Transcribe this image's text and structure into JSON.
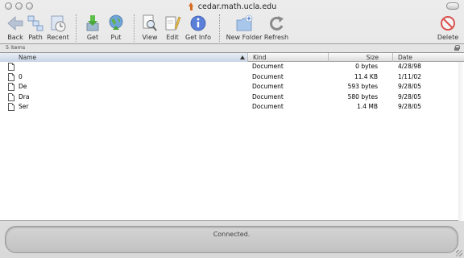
{
  "window": {
    "title": "cedar.math.ucla.edu"
  },
  "toolbar": {
    "back": "Back",
    "path": "Path",
    "recent": "Recent",
    "get": "Get",
    "put": "Put",
    "view": "View",
    "edit": "Edit",
    "get_info": "Get Info",
    "new_folder": "New Folder",
    "refresh": "Refresh",
    "delete": "Delete"
  },
  "status": {
    "item_count": "5 items",
    "connection": "Connected."
  },
  "table": {
    "columns": {
      "name": "Name",
      "kind": "Kind",
      "size": "Size",
      "date": "Date"
    },
    "rows": [
      {
        "name": "",
        "kind": "Document",
        "size": "0 bytes",
        "date": "4/28/98"
      },
      {
        "name": "0",
        "kind": "Document",
        "size": "11.4 KB",
        "date": "1/11/02"
      },
      {
        "name": "De",
        "kind": "Document",
        "size": "593 bytes",
        "date": "9/28/05"
      },
      {
        "name": "Dra",
        "kind": "Document",
        "size": "580 bytes",
        "date": "9/28/05"
      },
      {
        "name": "Ser",
        "kind": "Document",
        "size": "1.4 MB",
        "date": "9/28/05"
      }
    ]
  },
  "icons": {
    "back": "back-arrow-icon",
    "path": "path-icon",
    "recent": "recent-clock-icon",
    "get": "download-icon",
    "put": "upload-icon",
    "view": "view-magnifier-icon",
    "edit": "edit-pencil-icon",
    "get_info": "info-icon",
    "new_folder": "new-folder-icon",
    "refresh": "refresh-icon",
    "delete": "delete-icon",
    "file": "document-icon"
  },
  "colors": {
    "accent_blue": "#4a74c9",
    "info_blue": "#5a7fd8",
    "delete_red": "#d9534f",
    "sort_header": "#c9d4e6"
  }
}
